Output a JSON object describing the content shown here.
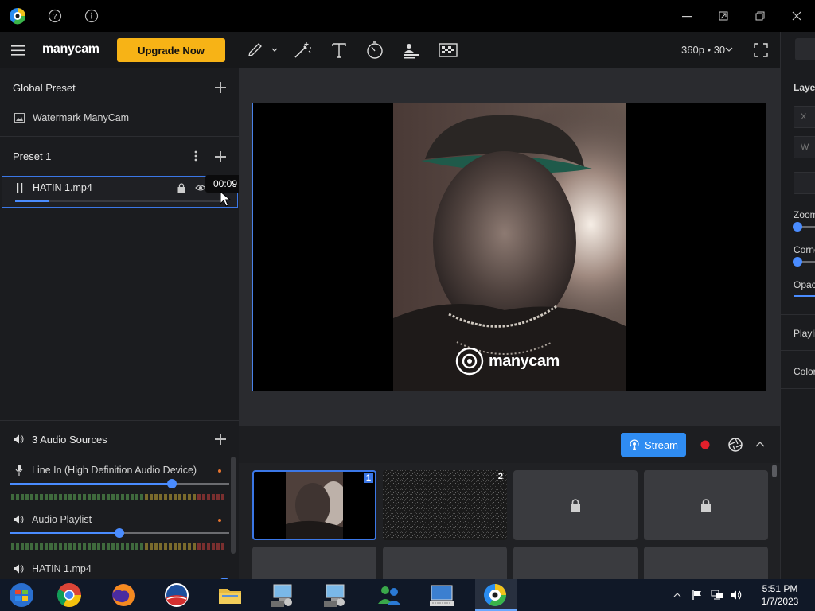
{
  "brand": {
    "name": "manycam",
    "upgrade_label": "Upgrade Now"
  },
  "left": {
    "global_preset_title": "Global Preset",
    "global_preset_item": "Watermark ManyCam",
    "preset_title": "Preset 1",
    "layer": {
      "name": "HATIN 1.mp4",
      "progress": 0.16,
      "tooltip": "00:09"
    },
    "audio": {
      "title": "3 Audio Sources",
      "sources": [
        {
          "name": "Line In (High Definition Audio Device)",
          "level": 0.74
        },
        {
          "name": "Audio Playlist",
          "level": 0.5
        },
        {
          "name": "HATIN 1.mp4",
          "level": 0.98
        }
      ]
    }
  },
  "toolbar": {
    "resolution": "360p • 30"
  },
  "preview": {
    "watermark": "manycam"
  },
  "scenes": {
    "stream_label": "Stream",
    "tiles": [
      {
        "num": "1",
        "state": "video"
      },
      {
        "num": "2",
        "state": "noise"
      },
      {
        "num": "",
        "state": "locked"
      },
      {
        "num": "",
        "state": "locked"
      }
    ]
  },
  "right": {
    "layer_label": "Layer",
    "x_label": "X",
    "w_label": "W",
    "zoom_label": "Zoom",
    "corner_label": "Corner",
    "opacity_label": "Opacity",
    "playlist_label": "Playlist",
    "color_label": "Color"
  },
  "taskbar": {
    "time": "5:51 PM",
    "date": "1/7/2023"
  }
}
